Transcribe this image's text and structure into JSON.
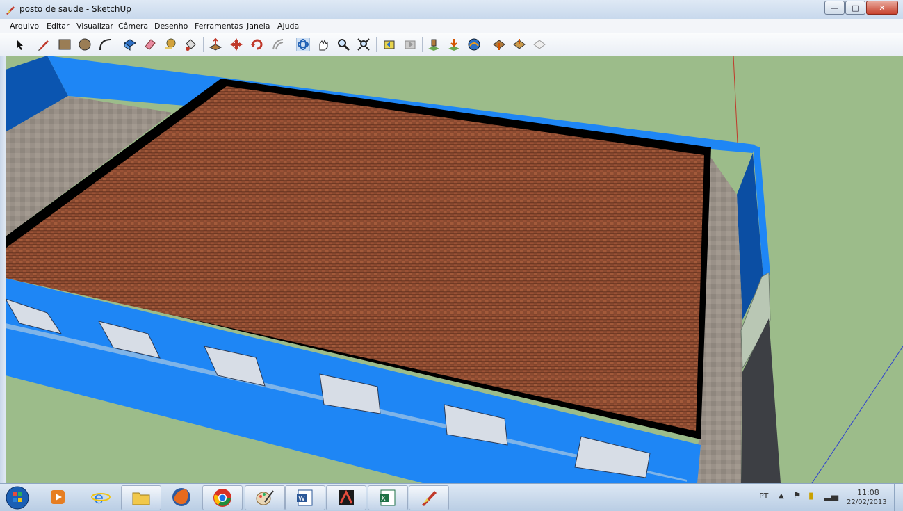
{
  "window": {
    "title": "posto de saude - SketchUp"
  },
  "menu": [
    "Arquivo",
    "Editar",
    "Visualizar",
    "Câmera",
    "Desenho",
    "Ferramentas",
    "Janela",
    "Ajuda"
  ],
  "toolbar": {
    "icons": [
      "select-icon",
      "pencil-icon",
      "rectangle-icon",
      "circle-icon",
      "arc-icon",
      "make-component-icon",
      "eraser-icon",
      "tape-measure-icon",
      "paint-bucket-icon",
      "push-pull-icon",
      "move-icon",
      "rotate-icon",
      "offset-icon",
      "orbit-icon",
      "pan-icon",
      "zoom-icon",
      "zoom-extents-icon",
      "previous-view-icon",
      "next-view-icon",
      "place-model-icon",
      "get-model-icon",
      "share-model-icon",
      "get-photo-texture-icon",
      "google-earth-icon",
      "preview-earth-icon"
    ]
  },
  "taskbar": {
    "apps": [
      "windows-media-player",
      "internet-explorer",
      "file-explorer",
      "firefox",
      "chrome",
      "paint",
      "word",
      "autocad",
      "excel",
      "sketchup"
    ],
    "language": "PT",
    "time": "11:08",
    "date": "22/02/2013"
  },
  "colors": {
    "wall": "#1a7ff0",
    "roof": "#8a4a30",
    "ground": "#9cbc8a",
    "floor": "#9a9188"
  }
}
